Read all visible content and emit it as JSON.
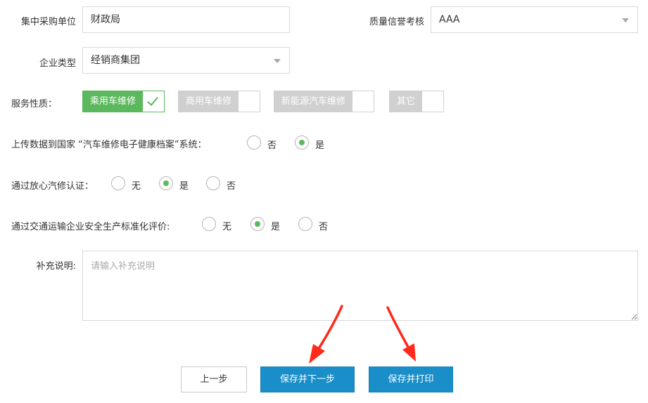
{
  "fields": {
    "procurement_unit": {
      "label": "集中采购单位",
      "value": "财政局"
    },
    "quality_rating": {
      "label": "质量信誉考核",
      "value": "AAA"
    },
    "company_type": {
      "label": "企业类型",
      "value": "经销商集团"
    },
    "service_nature": {
      "label": "服务性质：",
      "options": [
        {
          "label": "乘用车维修",
          "on": true
        },
        {
          "label": "商用车维修",
          "on": false
        },
        {
          "label": "新能源汽车维修",
          "on": false
        },
        {
          "label": "其它",
          "on": false
        }
      ]
    },
    "upload_data": {
      "label": "上传数据到国家 “汽车维修电子健康档案”系统：",
      "options": [
        {
          "label": "否",
          "checked": false
        },
        {
          "label": "是",
          "checked": true
        }
      ]
    },
    "trust_cert": {
      "label": "通过放心汽修认证：",
      "options": [
        {
          "label": "无",
          "checked": false
        },
        {
          "label": "是",
          "checked": true
        },
        {
          "label": "否",
          "checked": false
        }
      ]
    },
    "safety_eval": {
      "label": "通过交通运输企业安全生产标准化评价:",
      "options": [
        {
          "label": "无",
          "checked": false
        },
        {
          "label": "是",
          "checked": true
        },
        {
          "label": "否",
          "checked": false
        }
      ]
    },
    "supplement": {
      "label": "补充说明:",
      "placeholder": "请输入补充说明",
      "value": ""
    }
  },
  "buttons": {
    "prev": "上一步",
    "save_next": "保存并下一步",
    "save_print": "保存并打印"
  },
  "colors": {
    "accent_green": "#5cb85c",
    "primary_blue": "#1a8ec9",
    "annotation_red": "#ff2a1a",
    "toggle_off_gray": "#d0d0d0"
  }
}
